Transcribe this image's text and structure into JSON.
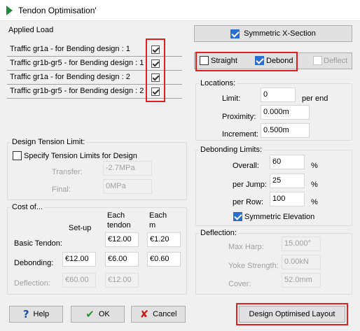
{
  "window": {
    "title": "Tendon Optimisation'"
  },
  "applied_load": {
    "title": "Applied Load",
    "rows": [
      {
        "label": "Traffic gr1a - for Bending design :  1",
        "checked": true
      },
      {
        "label": "Traffic gr1b-gr5 - for Bending design :  1",
        "checked": true
      },
      {
        "label": "Traffic gr1a - for Bending design :  2",
        "checked": true
      },
      {
        "label": "Traffic gr1b-gr5 - for Bending design :  2",
        "checked": true
      }
    ]
  },
  "symmetric_xsection": {
    "label": "Symmetric X-Section",
    "checked": true
  },
  "mode": {
    "straight": {
      "label": "Straight",
      "checked": false
    },
    "debond": {
      "label": "Debond",
      "checked": true
    },
    "deflect": {
      "label": "Deflect",
      "checked": false
    }
  },
  "locations": {
    "title": "Locations:",
    "limit_label": "Limit:",
    "limit_value": "0",
    "limit_unit": "per end",
    "proximity_label": "Proximity:",
    "proximity_value": "0.000m",
    "increment_label": "Increment:",
    "increment_value": "0.500m"
  },
  "tension": {
    "title": "Design Tension Limit:",
    "specify_label": "Specify Tension Limits for Design",
    "specify_checked": false,
    "transfer_label": "Transfer:",
    "transfer_value": "-2.7MPa",
    "final_label": "Final:",
    "final_value": "0MPa"
  },
  "debonding_limits": {
    "title": "Debonding Limits:",
    "overall_label": "Overall:",
    "overall_value": "60",
    "overall_unit": "%",
    "per_jump_label": "per Jump:",
    "per_jump_value": "25",
    "per_jump_unit": "%",
    "per_row_label": "per Row:",
    "per_row_value": "100",
    "per_row_unit": "%",
    "sym_elev_label": "Symmetric Elevation",
    "sym_elev_checked": true
  },
  "cost": {
    "title": "Cost of...",
    "col_setup": "Set-up",
    "col_each_tendon": "Each\ntendon",
    "col_each_m": "Each\nm",
    "basic_tendon_label": "Basic Tendon:",
    "basic_each_tendon": "€12.00",
    "basic_each_m": "€1.20",
    "debonding_label": "Debonding:",
    "debonding_setup": "€12.00",
    "debonding_each_tendon": "€6.00",
    "debonding_each_m": "€0.60",
    "deflection_label": "Deflection:",
    "deflection_setup": "€60.00",
    "deflection_each_tendon": "€12.00"
  },
  "deflection": {
    "title": "Deflection:",
    "max_harp_label": "Max Harp:",
    "max_harp_value": "15.000°",
    "yoke_label": "Yoke Strength:",
    "yoke_value": "0.00kN",
    "cover_label": "Cover:",
    "cover_value": "52.0mm"
  },
  "buttons": {
    "help": "Help",
    "ok": "OK",
    "cancel": "Cancel",
    "design": "Design Optimised Layout"
  },
  "colors": {
    "accent": "#2a6fd0",
    "highlight": "#e02020",
    "title_icon": "#1f8a3b"
  }
}
